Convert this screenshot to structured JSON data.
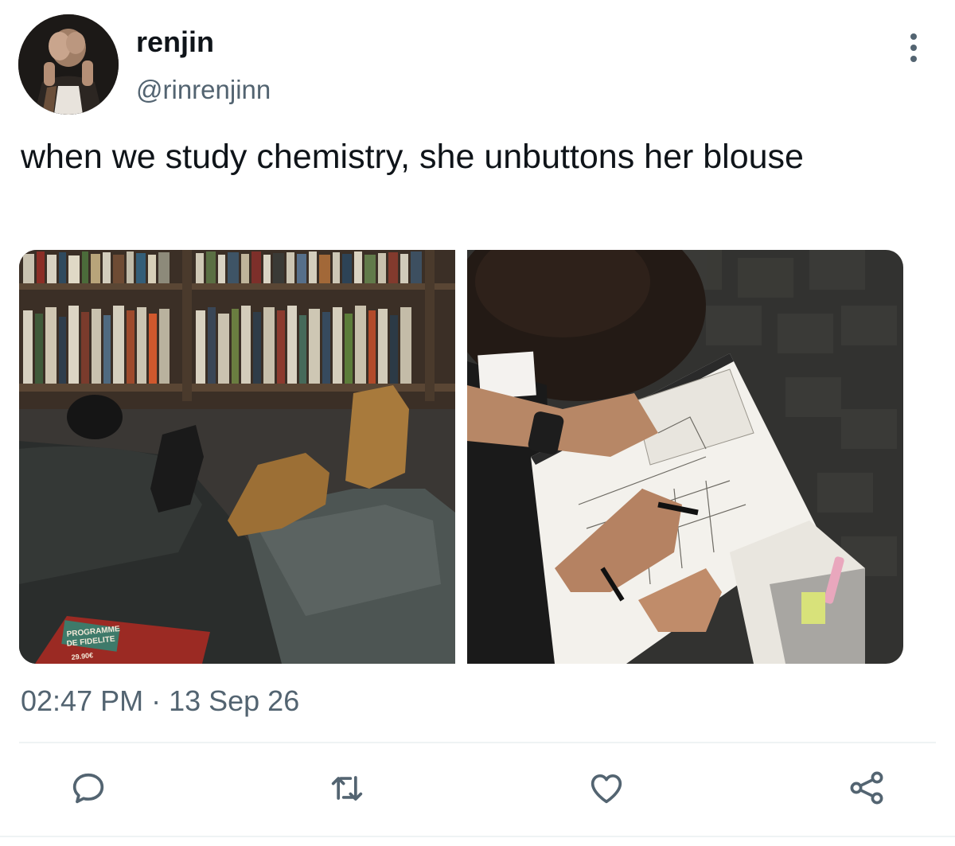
{
  "author": {
    "display_name": "renjin",
    "handle": "@rinrenjinn"
  },
  "tweet": {
    "text": "when we study chemistry, she unbuttons her blouse",
    "timestamp": "02:47 PM · 13 Sep 26"
  },
  "media": {
    "photo_left_book_text": [
      "PROGRAMME",
      "DE FIDELITE",
      "29.90€"
    ]
  },
  "actions": [
    {
      "name": "reply",
      "icon": "speech-bubble-icon"
    },
    {
      "name": "retweet",
      "icon": "retweet-arrows-icon"
    },
    {
      "name": "like",
      "icon": "heart-icon"
    },
    {
      "name": "share",
      "icon": "share-nodes-icon"
    }
  ],
  "colors": {
    "primary_text": "#0f1419",
    "secondary_text": "#536471",
    "icon": "#536471",
    "divider": "#eff3f4"
  }
}
